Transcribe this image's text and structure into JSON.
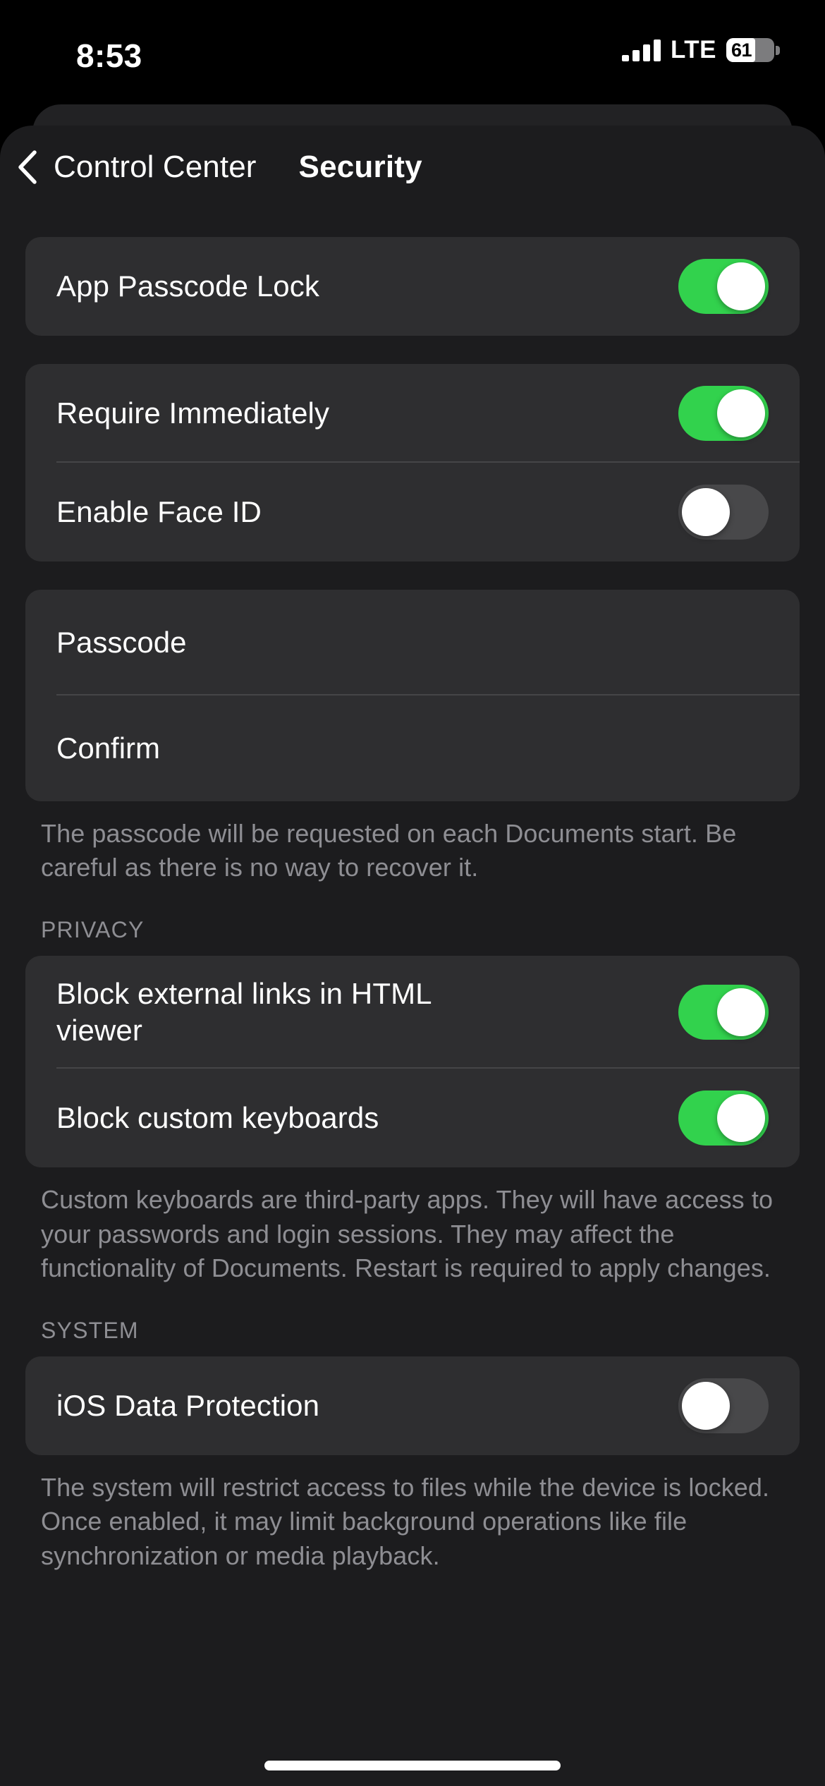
{
  "status_bar": {
    "time": "8:53",
    "carrier_network": "LTE",
    "battery_percent": "61",
    "signal_bars": 4
  },
  "nav": {
    "back_label": "Control Center",
    "title": "Security",
    "back_icon": "chevron-left-icon"
  },
  "sections": [
    {
      "id": "app-passcode-lock",
      "rows": [
        {
          "label": "App Passcode Lock",
          "control": "toggle",
          "value": "on"
        }
      ]
    },
    {
      "id": "require-faceid",
      "rows": [
        {
          "label": "Require Immediately",
          "control": "toggle",
          "value": "on"
        },
        {
          "label": "Enable Face ID",
          "control": "toggle",
          "value": "off"
        }
      ]
    },
    {
      "id": "passcode-fields",
      "rows": [
        {
          "label": "Passcode",
          "control": "text-field",
          "value": ""
        },
        {
          "label": "Confirm",
          "control": "text-field",
          "value": ""
        }
      ],
      "footer": "The passcode will be requested on each Documents start. Be careful as there is no way to recover it."
    },
    {
      "id": "privacy",
      "header": "PRIVACY",
      "rows": [
        {
          "label": "Block external links in HTML viewer",
          "control": "toggle",
          "value": "on"
        },
        {
          "label": "Block custom keyboards",
          "control": "toggle",
          "value": "on"
        }
      ],
      "footer": "Custom keyboards are third-party apps. They will have access to your passwords and login sessions. They may affect the functionality of Documents. Restart is required to apply changes."
    },
    {
      "id": "system",
      "header": "SYSTEM",
      "rows": [
        {
          "label": "iOS Data Protection",
          "control": "toggle",
          "value": "off"
        }
      ],
      "footer": "The system will restrict access to files while the device is locked. Once enabled, it may limit background operations like file synchronization or media playback."
    }
  ],
  "colors": {
    "toggle_on": "#32d24d",
    "toggle_off": "#48484a",
    "card_background": "#2e2e30",
    "page_background": "#1c1c1e",
    "secondary_text": "#8e8e93"
  }
}
